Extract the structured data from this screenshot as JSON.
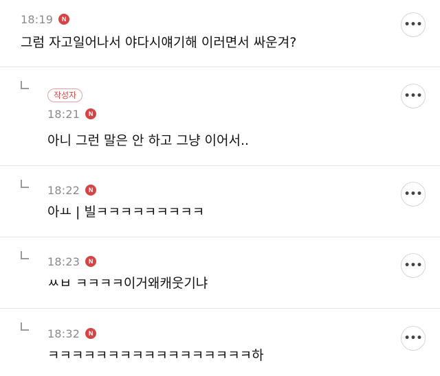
{
  "comments": [
    {
      "time": "18:19",
      "new_badge": "N",
      "text": "그럼 자고일어나서 야다시얘기해 이러면서 싸운겨?",
      "more": "•••"
    },
    {
      "author_badge": "작성자",
      "time": "18:21",
      "new_badge": "N",
      "text": "아니 그런 말은 안 하고 그냥 이어서..",
      "more": "•••"
    },
    {
      "time": "18:22",
      "new_badge": "N",
      "text": "아ㅛ | 빌ㅋㅋㅋㅋㅋㅋㅋㅋㅋ",
      "more": "•••"
    },
    {
      "time": "18:23",
      "new_badge": "N",
      "text": "ㅆㅂ ㅋㅋㅋㅋ이거왜캐웃기냐",
      "more": "•••"
    },
    {
      "time": "18:32",
      "new_badge": "N",
      "text": "ㅋㅋㅋㅋㅋㅋㅋㅋㅋㅋㅋㅋㅋㅋㅋㅋㅋ하",
      "more": "•••"
    }
  ],
  "colors": {
    "new_badge": "#d64545",
    "author_badge": "#d24848",
    "divider": "#e6e6e6",
    "time": "#8a8a8a"
  }
}
